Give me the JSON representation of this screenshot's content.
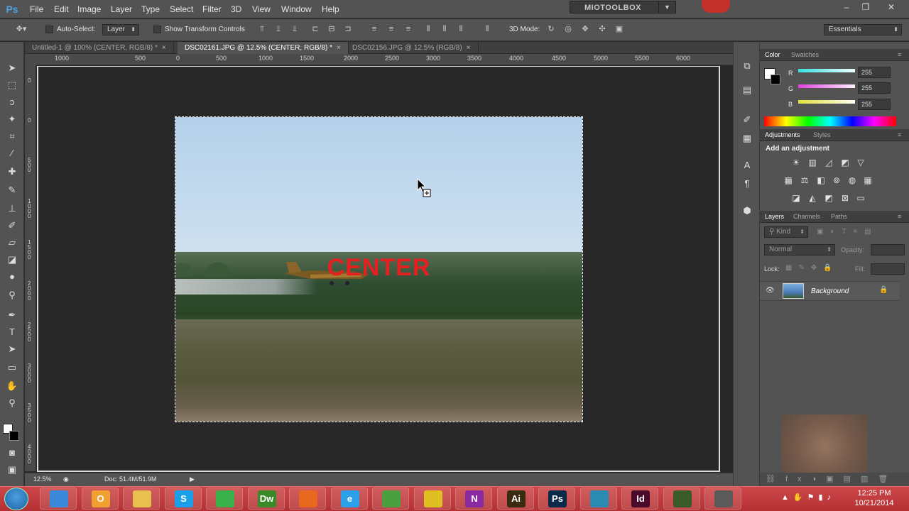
{
  "app": {
    "logo": "Ps",
    "menu": [
      "File",
      "Edit",
      "Image",
      "Layer",
      "Type",
      "Select",
      "Filter",
      "3D",
      "View",
      "Window",
      "Help"
    ],
    "workspace_label": "MIOTOOLBOX"
  },
  "options": {
    "auto_select_label": "Auto-Select:",
    "auto_select_value": "Layer",
    "show_transform_label": "Show Transform Controls",
    "mode_label": "3D Mode:",
    "workspace_select": "Essentials"
  },
  "tabs": [
    {
      "label": "Untitled-1 @ 100% (CENTER, RGB/8) *",
      "close": "×"
    },
    {
      "label": "DSC02161.JPG @ 12.5% (CENTER, RGB/8) *",
      "close": "×"
    },
    {
      "label": "DSC02156.JPG @ 12.5% (RGB/8)",
      "close": "×"
    }
  ],
  "ruler_top": [
    "1000",
    "500",
    "0",
    "500",
    "1000",
    "1500",
    "2000",
    "2500",
    "3000",
    "3500",
    "4000",
    "4500",
    "5000",
    "5500",
    "6000"
  ],
  "ruler_left": [
    "0",
    "0",
    "5 0 0",
    "1 0 0 0",
    "1 5 0 0",
    "2 0 0 0",
    "2 5 0 0",
    "3 0 0 0",
    "3 5 0 0",
    "4 0 0 0",
    "4 5 0 0",
    "5 0 0 0",
    "5 5 0 0"
  ],
  "canvas": {
    "overlay_text": "CENTER"
  },
  "status": {
    "zoom": "12.5%",
    "doc_info": "Doc: 51.4M/51.9M"
  },
  "color_panel": {
    "tabs": [
      "Color",
      "Swatches"
    ],
    "channels": [
      {
        "label": "R",
        "value": "255",
        "color": "#35e0e0"
      },
      {
        "label": "G",
        "value": "255",
        "color": "#e040e0"
      },
      {
        "label": "B",
        "value": "255",
        "color": "#e0e040"
      }
    ]
  },
  "adjustments_panel": {
    "tabs": [
      "Adjustments",
      "Styles"
    ],
    "heading": "Add an adjustment"
  },
  "layers_panel": {
    "tabs": [
      "Layers",
      "Channels",
      "Paths"
    ],
    "filter_kind": "Kind",
    "blend_mode": "Normal",
    "opacity_label": "Opacity:",
    "lock_label": "Lock:",
    "fill_label": "Fill:",
    "layers": [
      {
        "name": "Background",
        "visible": true,
        "locked": true
      }
    ]
  },
  "taskbar": {
    "apps": [
      {
        "name": "ie-like",
        "letter": "",
        "color": "#3a88d8"
      },
      {
        "name": "outlook",
        "letter": "O",
        "color": "#f0a030"
      },
      {
        "name": "explorer",
        "letter": "",
        "color": "#e8c050"
      },
      {
        "name": "skype",
        "letter": "S",
        "color": "#1aa0e8"
      },
      {
        "name": "visual-studio",
        "letter": "",
        "color": "#3ab04a"
      },
      {
        "name": "dreamweaver",
        "letter": "Dw",
        "color": "#3a8a2a"
      },
      {
        "name": "firefox",
        "letter": "",
        "color": "#e86820"
      },
      {
        "name": "internet-explorer",
        "letter": "e",
        "color": "#2aa0e8"
      },
      {
        "name": "project",
        "letter": "",
        "color": "#4aa040"
      },
      {
        "name": "chrome",
        "letter": "",
        "color": "#e0c020"
      },
      {
        "name": "onenote",
        "letter": "N",
        "color": "#8a2aa0"
      },
      {
        "name": "illustrator",
        "letter": "Ai",
        "color": "#3a2a10"
      },
      {
        "name": "photoshop",
        "letter": "Ps",
        "color": "#0a2a4a"
      },
      {
        "name": "tool-a",
        "letter": "",
        "color": "#2a8ab0"
      },
      {
        "name": "indesign",
        "letter": "Id",
        "color": "#4a0a2a"
      },
      {
        "name": "tool-b",
        "letter": "",
        "color": "#3a5a2a"
      },
      {
        "name": "tool-c",
        "letter": "",
        "color": "#5a5a5a"
      }
    ],
    "time": "12:25 PM",
    "date": "10/21/2014"
  }
}
